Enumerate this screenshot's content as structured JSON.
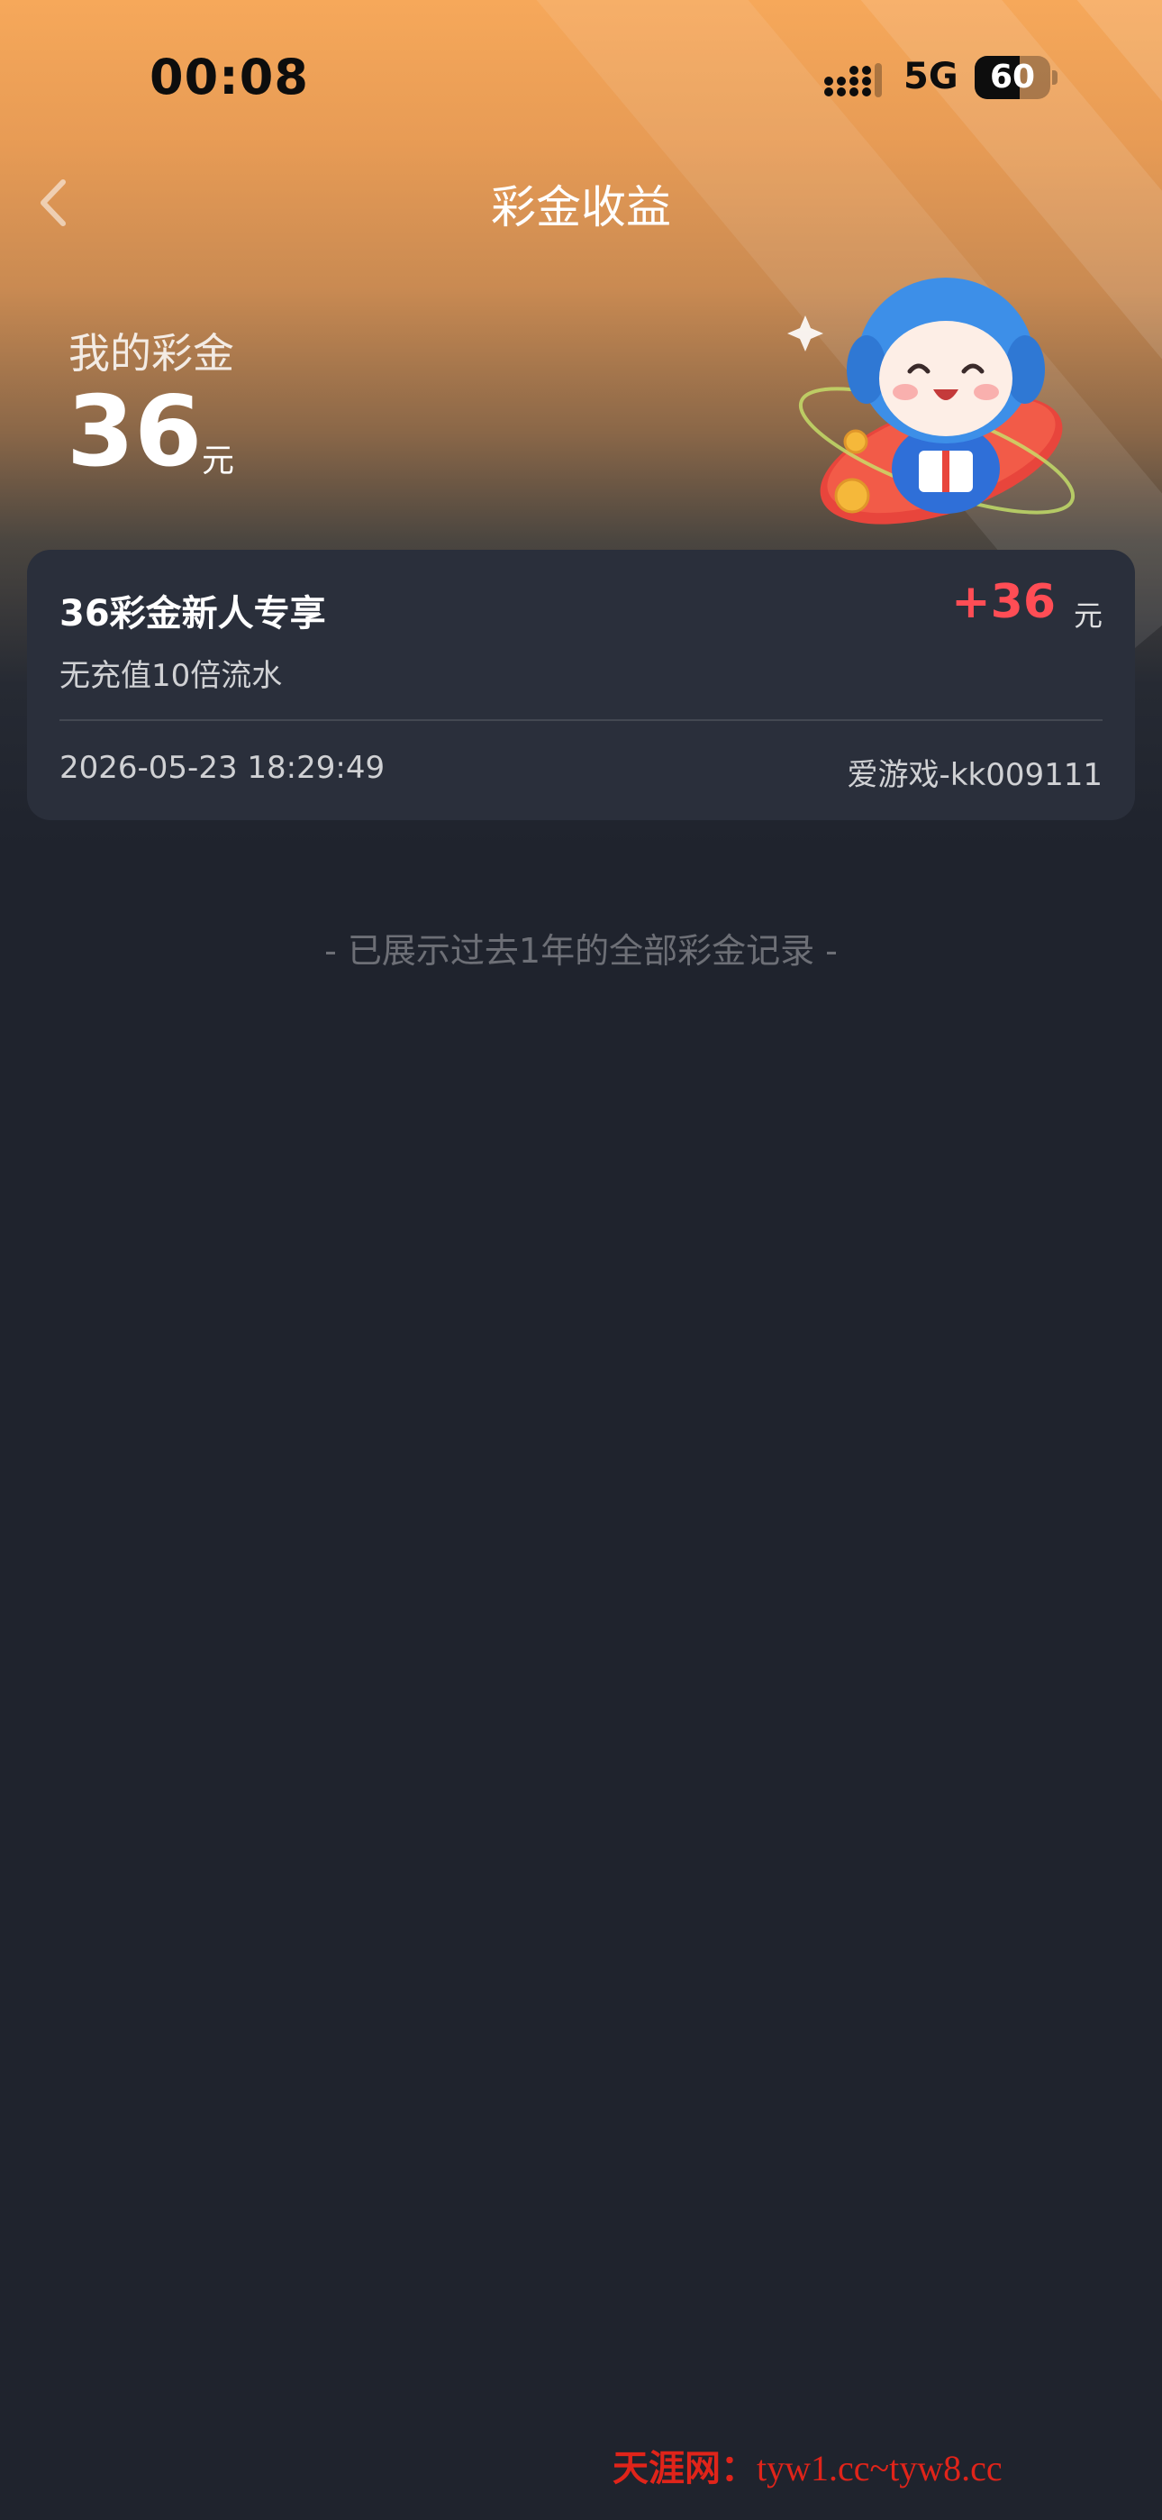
{
  "status_bar": {
    "time": "00:08",
    "network": "5G",
    "battery_level": "60",
    "battery_fraction": 0.6,
    "signal_icon": "cellular-signal-icon"
  },
  "nav": {
    "title": "彩金收益",
    "back_icon": "chevron-left-icon"
  },
  "balance": {
    "label": "我的彩金",
    "amount": "36",
    "unit": "元"
  },
  "records": [
    {
      "title": "36彩金新人专享",
      "subtitle": "无充值10倍流水",
      "amount": "+36",
      "unit": "元",
      "time": "2026-05-23 18:29:49",
      "source": "爱游戏-kk009111"
    }
  ],
  "end_note": "- 已展示过去1年的全部彩金记录 -",
  "watermark": {
    "name": "天涯网：",
    "url": "tyw1.cc~tyw8.cc"
  },
  "colors": {
    "background": "#1f232d",
    "card": "#2a2f3b",
    "accent_orange": "#f6a85a",
    "amount_red": "#ff4d55",
    "watermark_red": "#e0241a"
  }
}
